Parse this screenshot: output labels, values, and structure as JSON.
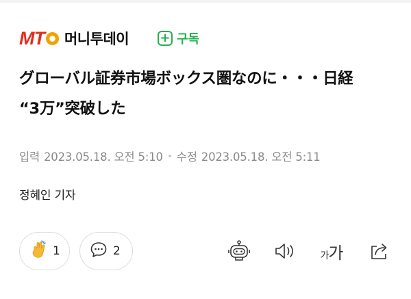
{
  "brand": {
    "logo_text": "MTO",
    "name": "머니투데이"
  },
  "subscribe": {
    "plus": "+",
    "label": "구독"
  },
  "headline": {
    "line1": "グローバル証券市場ボックス圏なのに・・・日経",
    "line2": "“3万”突破した"
  },
  "meta": {
    "published_label": "입력",
    "published": "2023.05.18. 오전 5:10",
    "modified_label": "수정",
    "modified": "2023.05.18. 오전 5:11"
  },
  "reporter": "정혜인 기자",
  "reactions": {
    "like_count": "1",
    "comment_count": "2"
  },
  "toolbar": {
    "font_small": "가",
    "font_large": "가"
  },
  "colors": {
    "brand_red": "#e8291c",
    "brand_orange": "#f1a200",
    "subscribe_green": "#22b24c",
    "meta_gray": "#8a8a8a"
  },
  "icons": [
    "clap-icon",
    "comment-icon",
    "robot-summary-icon",
    "speaker-icon",
    "font-size-icon",
    "share-icon"
  ]
}
